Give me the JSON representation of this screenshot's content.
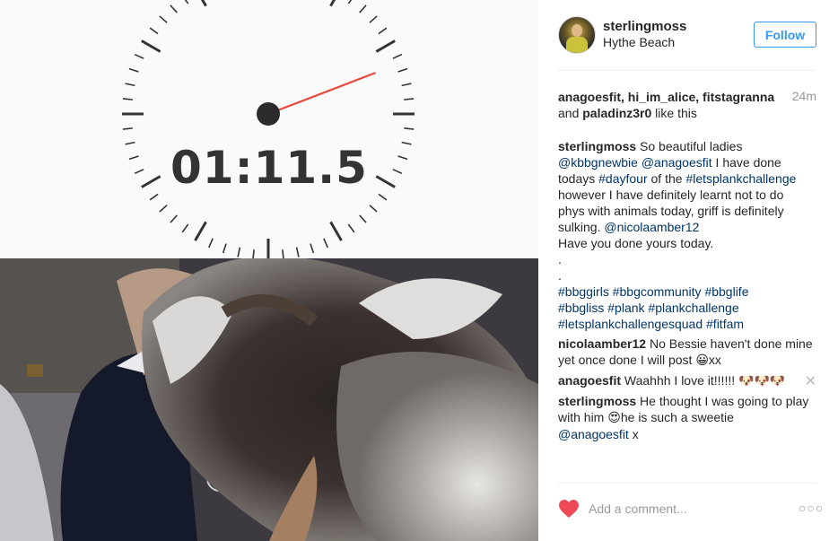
{
  "timer": {
    "readout": "01:11.5"
  },
  "post": {
    "username": "sterlingmoss",
    "location": "Hythe Beach",
    "follow_label": "Follow",
    "likes_users": "anagoesfit, hi_im_alice, fitstagranna",
    "likes_and": "and",
    "likes_last": "paladinz3r0",
    "likes_suffix": "like this",
    "timestamp": "24m"
  },
  "caption": {
    "user": "sterlingmoss",
    "lines": [
      {
        "parts": [
          {
            "t": "So beautiful ladies",
            "link": false
          }
        ]
      },
      {
        "parts": [
          {
            "t": "@kbbgnewbie",
            "link": true
          },
          {
            "t": " ",
            "link": false
          },
          {
            "t": "@anagoesfit",
            "link": true
          },
          {
            "t": " I have done",
            "link": false
          }
        ]
      },
      {
        "parts": [
          {
            "t": "todays ",
            "link": false
          },
          {
            "t": "#dayfour",
            "link": true
          },
          {
            "t": " of the ",
            "link": false
          },
          {
            "t": "#letsplankchallenge",
            "link": true
          }
        ]
      },
      {
        "parts": [
          {
            "t": "however I have definitely learnt not to do",
            "link": false
          }
        ]
      },
      {
        "parts": [
          {
            "t": "phys with animals today, griff is definitely",
            "link": false
          }
        ]
      },
      {
        "parts": [
          {
            "t": "sulking. ",
            "link": false
          },
          {
            "t": "@nicolaamber12",
            "link": true
          }
        ]
      },
      {
        "parts": [
          {
            "t": "Have you done yours today.",
            "link": false
          }
        ]
      },
      {
        "parts": [
          {
            "t": ".",
            "link": false
          }
        ]
      },
      {
        "parts": [
          {
            "t": ".",
            "link": false
          }
        ]
      },
      {
        "parts": [
          {
            "t": "#bbggirls",
            "link": true
          },
          {
            "t": " ",
            "link": false
          },
          {
            "t": "#bbgcommunity",
            "link": true
          },
          {
            "t": " ",
            "link": false
          },
          {
            "t": "#bbglife",
            "link": true
          }
        ]
      },
      {
        "parts": [
          {
            "t": "#bbgliss",
            "link": true
          },
          {
            "t": " ",
            "link": false
          },
          {
            "t": "#plank",
            "link": true
          },
          {
            "t": " ",
            "link": false
          },
          {
            "t": "#plankchallenge",
            "link": true
          }
        ]
      },
      {
        "parts": [
          {
            "t": "#letsplankchallengesquad",
            "link": true
          },
          {
            "t": " ",
            "link": false
          },
          {
            "t": "#fitfam",
            "link": true
          }
        ]
      }
    ]
  },
  "comments": [
    {
      "user": "nicolaamber12",
      "text": "No Bessie haven't done mine yet once done I will post",
      "emoji": "😀",
      "after": "xx"
    },
    {
      "user": "anagoesfit",
      "text": "Waahhh I love it!!!!!!",
      "emoji": "🐶🐶🐶",
      "after": "",
      "removable": true,
      "remove_glyph": "✕"
    },
    {
      "user": "sterlingmoss",
      "text": "He thought I was going to play with him",
      "emoji": "😍",
      "after": "he is such a sweetie",
      "mention": "@anagoesfit",
      "tail": " x"
    }
  ],
  "footer": {
    "comment_placeholder": "Add a comment...",
    "heart_color": "#ed4956",
    "more_glyph": "○○○"
  },
  "icons": {
    "heart": "heart-icon",
    "more": "more-options-icon",
    "close": "close-icon"
  }
}
